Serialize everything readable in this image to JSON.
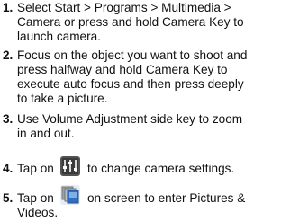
{
  "steps": [
    {
      "number": "1.",
      "lines": [
        "Select Start > Programs > Multimedia >",
        "Camera or press and hold Camera Key to",
        "launch camera."
      ]
    },
    {
      "number": "2.",
      "lines": [
        "Focus on the object you want to shoot and",
        "press halfway and hold Camera Key to",
        "execute auto focus and then press deeply",
        "to take a picture."
      ]
    },
    {
      "number": "3.",
      "lines": [
        "Use Volume Adjustment side key to zoom",
        "in and out."
      ]
    },
    {
      "number": "4.",
      "before_icon": "Tap on",
      "icon": "camera-settings-icon",
      "after_icon": "to change camera settings."
    },
    {
      "number": "5.",
      "before_icon": "Tap on",
      "icon": "pictures-videos-icon",
      "after_icon": "on screen to enter Pictures &",
      "lines": [
        "Videos."
      ]
    }
  ],
  "colors": {
    "text": "#111111",
    "icon_dark": "#3a3a3a",
    "icon_blue": "#2e6fc2",
    "icon_gray": "#9aa1a8"
  }
}
